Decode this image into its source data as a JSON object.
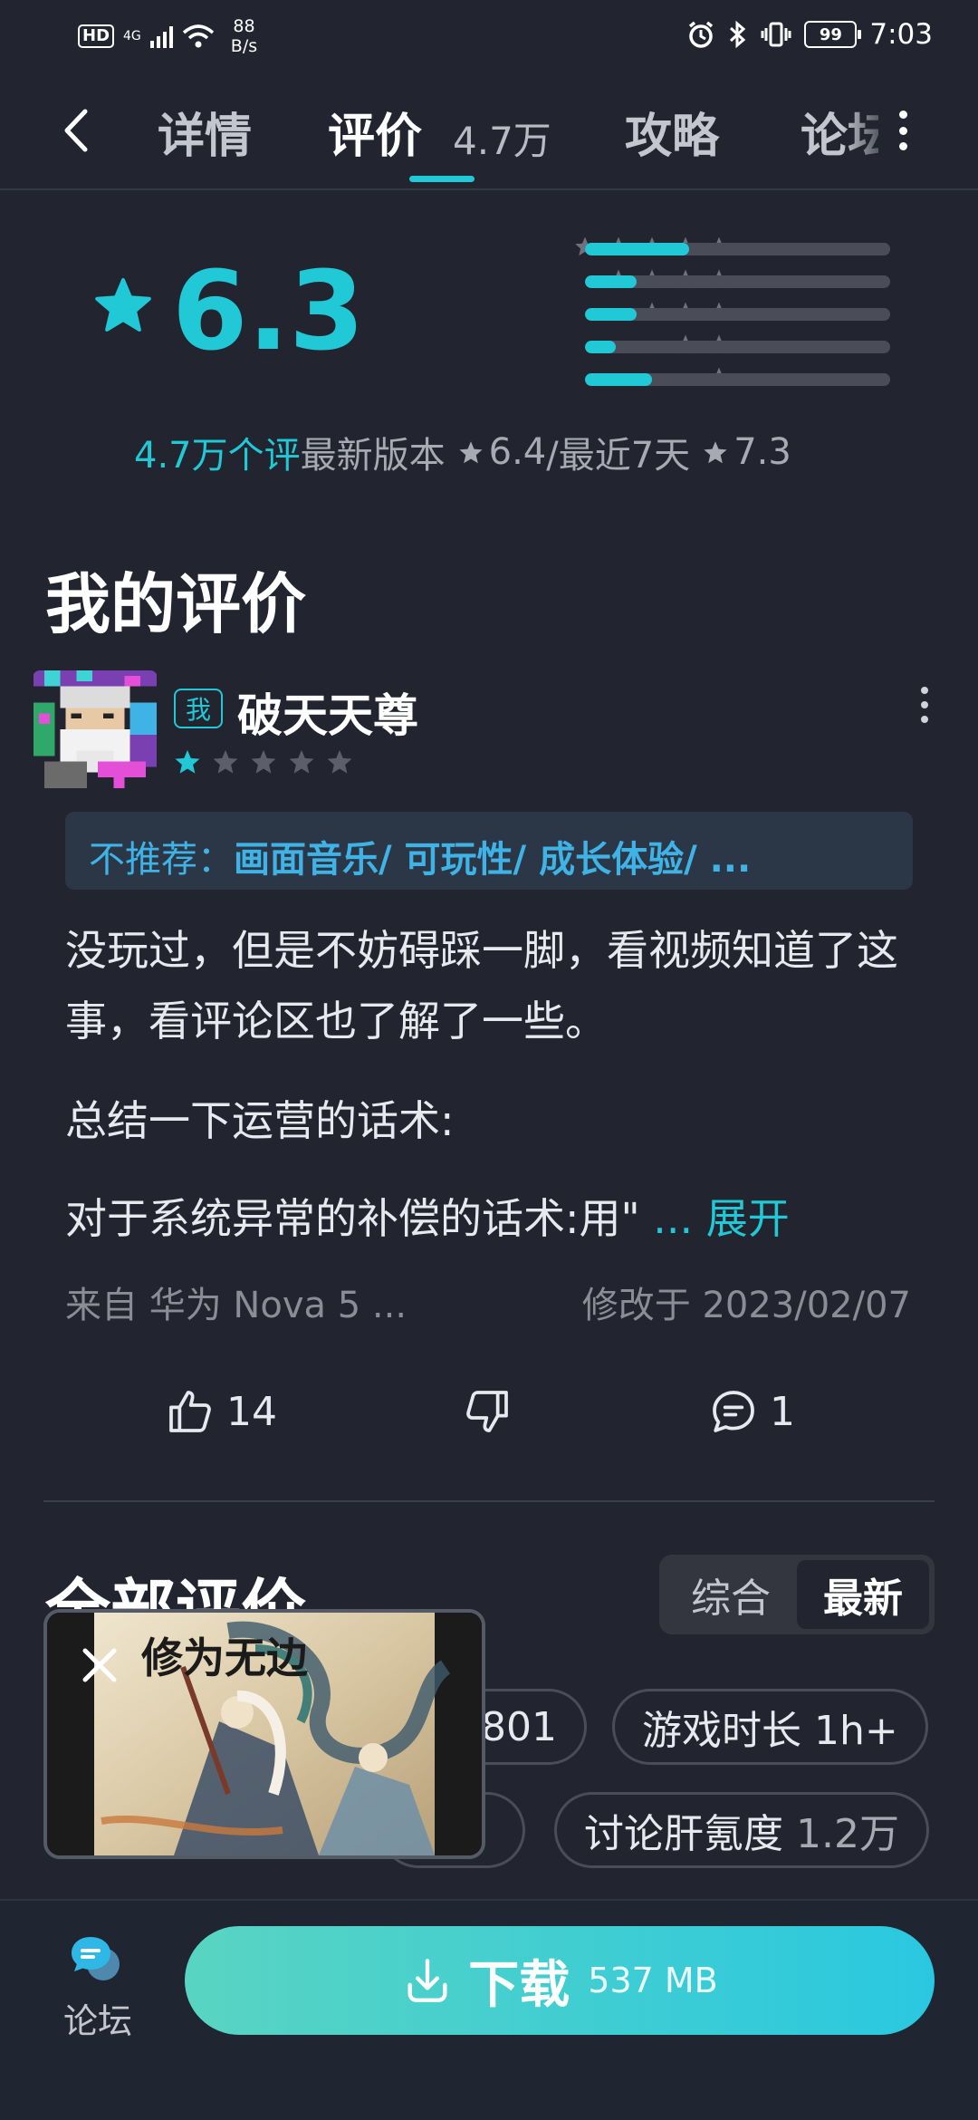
{
  "status_bar": {
    "hd": "HD",
    "network": "4G",
    "speed_value": "88",
    "speed_unit": "B/s",
    "battery": "99",
    "time": "7:03"
  },
  "nav": {
    "tabs": [
      {
        "label": "详情",
        "active": false
      },
      {
        "label": "评价",
        "active": true
      },
      {
        "label": "攻略",
        "active": false
      },
      {
        "label": "论坛",
        "active": false
      }
    ],
    "review_count": "4.7万"
  },
  "rating": {
    "score": "6.3",
    "distribution": [
      {
        "stars": 5,
        "fraction": 0.34
      },
      {
        "stars": 4,
        "fraction": 0.17
      },
      {
        "stars": 3,
        "fraction": 0.17
      },
      {
        "stars": 2,
        "fraction": 0.1
      },
      {
        "stars": 1,
        "fraction": 0.22
      }
    ],
    "count_text": "4.7万个评",
    "latest_version_label": "最新版本",
    "latest_version_score": "6.4",
    "recent_label": "/最近7天",
    "recent_score": "7.3"
  },
  "my_review": {
    "section_title": "我的评价",
    "me_badge": "我",
    "username": "破天天尊",
    "stars": 1,
    "tag_label": "不推荐：",
    "tag_items": "画面音乐/ 可玩性/ 成长体验/ ...",
    "paragraphs": [
      "没玩过，但是不妨碍踩一脚，看视频知道了这事，看评论区也了解了一些。",
      "总结一下运营的话术:",
      "对于系统异常的补偿的话术:用\" "
    ],
    "expand_label": "... 展开",
    "device": "来自 华为 Nova 5 ...",
    "modified": "修改于 2023/02/07",
    "likes": "14",
    "comments": "1"
  },
  "all_reviews": {
    "title": "全部评价",
    "sort_options": [
      "综合",
      "最新"
    ],
    "sort_selected": "最新",
    "chips": [
      {
        "label": "",
        "count": "801"
      },
      {
        "label": "游戏时长 1h+",
        "count": ""
      },
      {
        "label": "讨论肝氪度",
        "count": "1.2万"
      }
    ]
  },
  "floating_video": {
    "caption": "修为无边"
  },
  "bottom": {
    "forum_label": "论坛",
    "download_label": "下载",
    "download_size": "537 MB"
  },
  "colors": {
    "accent": "#21c8d6",
    "background": "#22252f",
    "tag_blue": "#3fb3e6"
  }
}
